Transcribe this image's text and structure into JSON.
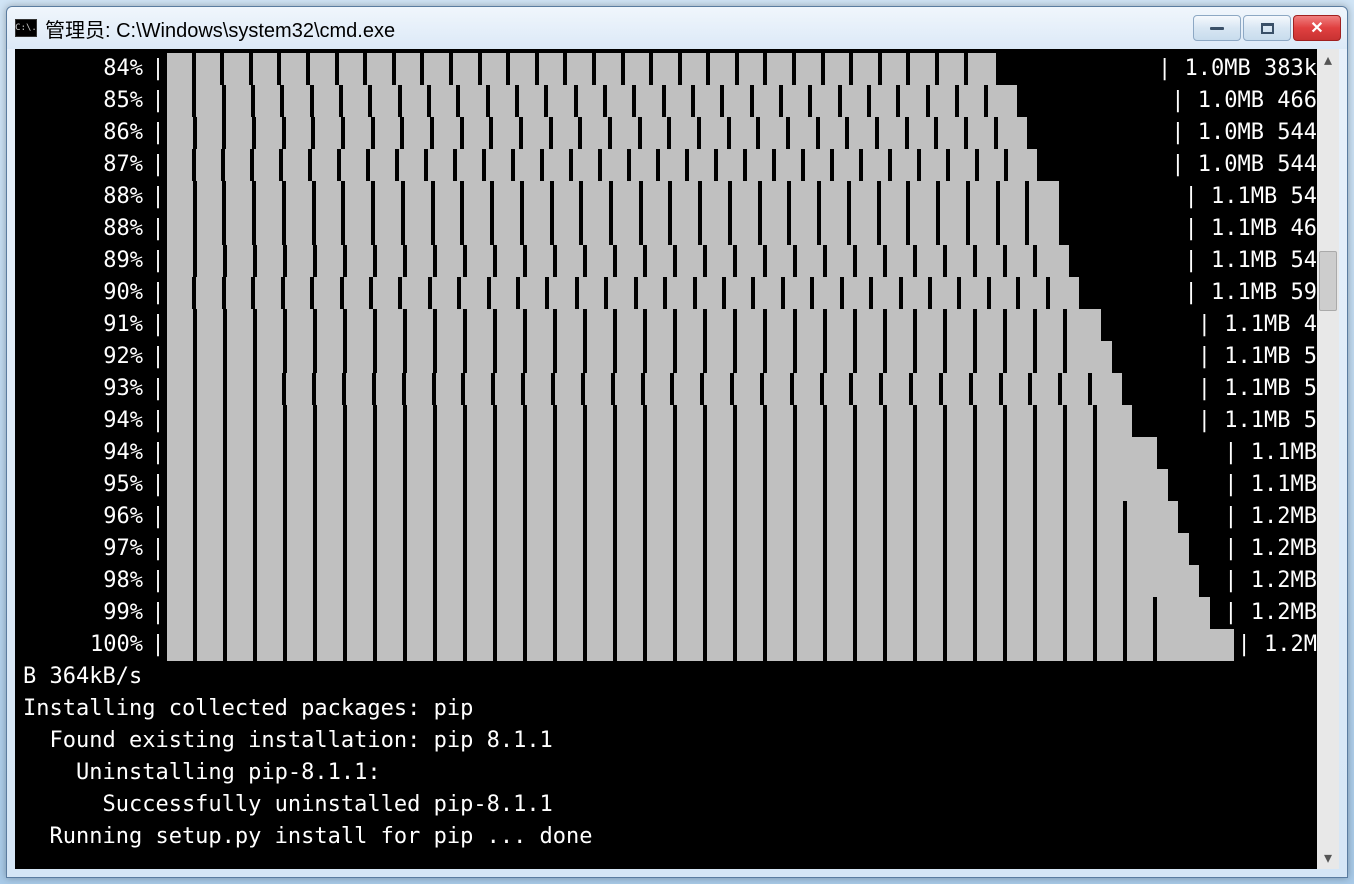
{
  "window": {
    "title": "管理员: C:\\Windows\\system32\\cmd.exe",
    "icon_label": "C:\\."
  },
  "progress_rows": [
    {
      "pct": "84%",
      "fill": 84,
      "tail": "| 1.0MB 383k"
    },
    {
      "pct": "85%",
      "fill": 85,
      "tail": "| 1.0MB 466"
    },
    {
      "pct": "86%",
      "fill": 86,
      "tail": "| 1.0MB 544"
    },
    {
      "pct": "87%",
      "fill": 87,
      "tail": "| 1.0MB 544"
    },
    {
      "pct": "88%",
      "fill": 88,
      "tail": "| 1.1MB 54"
    },
    {
      "pct": "88%",
      "fill": 88,
      "tail": "| 1.1MB 46"
    },
    {
      "pct": "89%",
      "fill": 89,
      "tail": "| 1.1MB 54"
    },
    {
      "pct": "90%",
      "fill": 90,
      "tail": "| 1.1MB 59"
    },
    {
      "pct": "91%",
      "fill": 91,
      "tail": "| 1.1MB 4"
    },
    {
      "pct": "92%",
      "fill": 92,
      "tail": "| 1.1MB 5"
    },
    {
      "pct": "93%",
      "fill": 93,
      "tail": "| 1.1MB 5"
    },
    {
      "pct": "94%",
      "fill": 94,
      "tail": "| 1.1MB 5"
    },
    {
      "pct": "94%",
      "fill": 94,
      "tail": "| 1.1MB"
    },
    {
      "pct": "95%",
      "fill": 95,
      "tail": "| 1.1MB"
    },
    {
      "pct": "96%",
      "fill": 96,
      "tail": "| 1.2MB"
    },
    {
      "pct": "97%",
      "fill": 97,
      "tail": "| 1.2MB"
    },
    {
      "pct": "98%",
      "fill": 98,
      "tail": "| 1.2MB"
    },
    {
      "pct": "99%",
      "fill": 99,
      "tail": "| 1.2MB"
    },
    {
      "pct": "100%",
      "fill": 100,
      "tail": "| 1.2M"
    }
  ],
  "below_lines": [
    "B 364kB/s",
    "Installing collected packages: pip",
    "  Found existing installation: pip 8.1.1",
    "    Uninstalling pip-8.1.1:",
    "      Successfully uninstalled pip-8.1.1",
    "  Running setup.py install for pip ... done"
  ],
  "sep_char": "|"
}
